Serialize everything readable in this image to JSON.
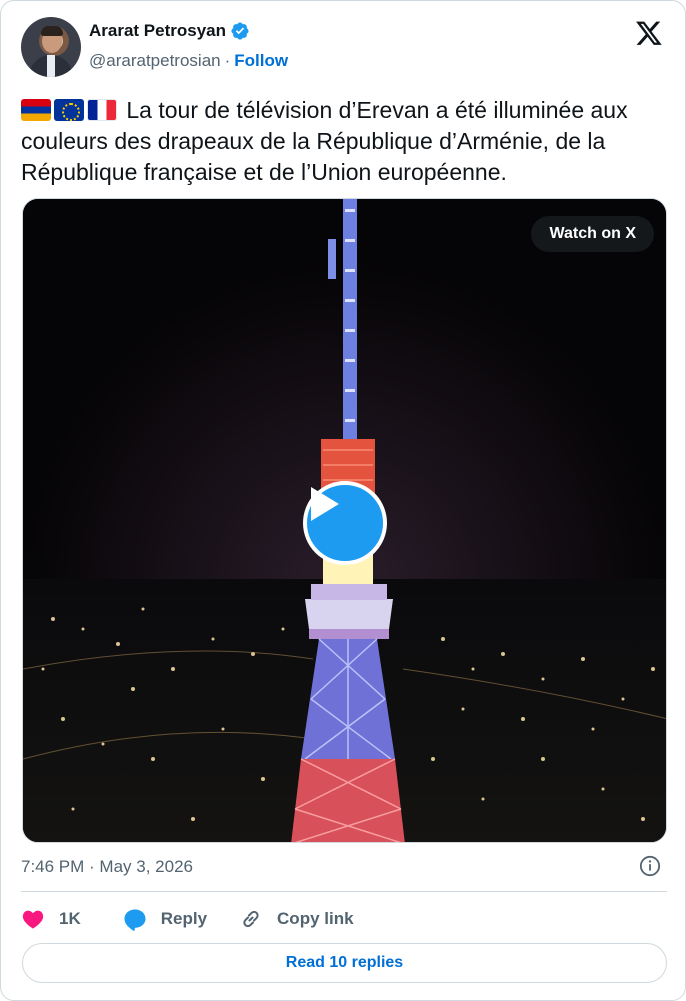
{
  "author": {
    "display_name": "Ararat Petrosyan",
    "handle": "@araratpetrosian",
    "separator": "·",
    "follow_label": "Follow",
    "verified": true
  },
  "tweet": {
    "flags": [
      "armenia-flag",
      "eu-flag",
      "france-flag"
    ],
    "text": "La tour de télévision d’Erevan a été illuminée aux couleurs des drapeaux de la République d’Arménie, de la République française et de l’Union européenne."
  },
  "media": {
    "watch_label": "Watch on X",
    "type": "video"
  },
  "footer": {
    "timestamp": "7:46 PM · May 3, 2026",
    "likes": "1K",
    "reply_label": "Reply",
    "copy_link_label": "Copy link",
    "read_replies_label": "Read 10 replies"
  },
  "colors": {
    "accent": "#1d9bf0",
    "link": "#006fd6",
    "like": "#f91880",
    "muted": "#536471",
    "border": "#cfd9de"
  }
}
